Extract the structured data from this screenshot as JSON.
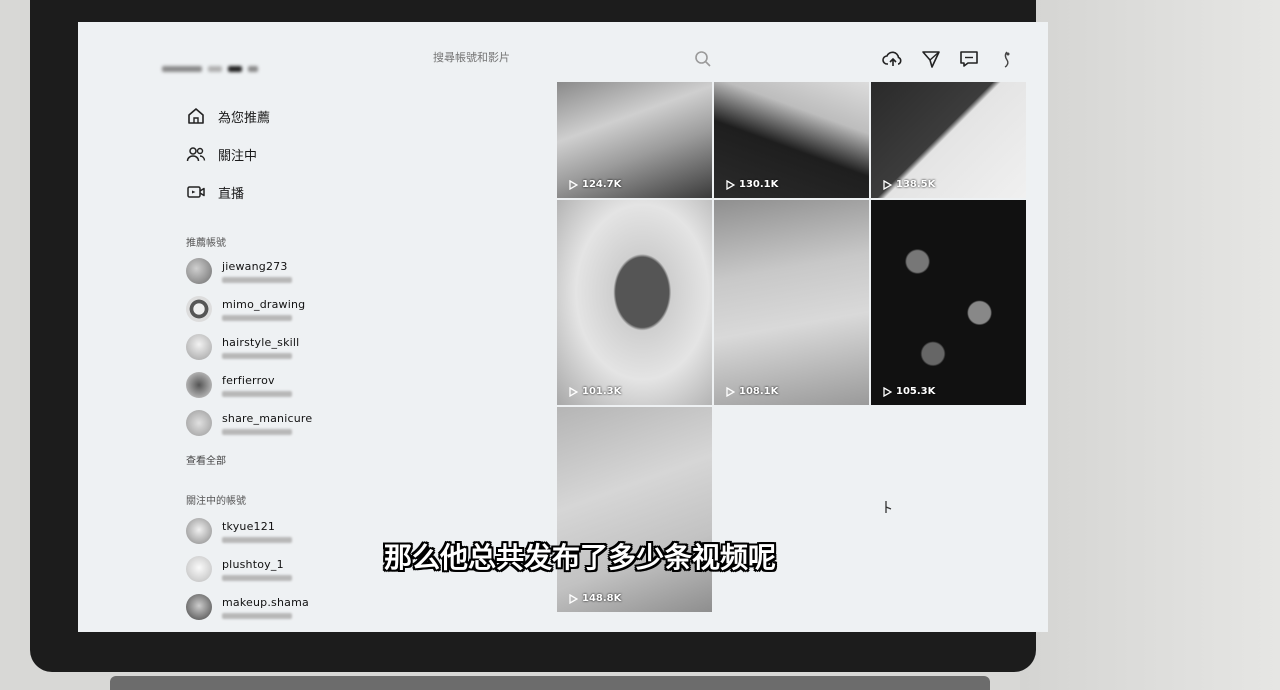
{
  "search": {
    "placeholder": "搜尋帳號和影片"
  },
  "nav": [
    {
      "label": "為您推薦",
      "icon": "home-icon"
    },
    {
      "label": "關注中",
      "icon": "users-icon"
    },
    {
      "label": "直播",
      "icon": "live-video-icon"
    }
  ],
  "sections": {
    "suggested": "推薦帳號",
    "see_all": "查看全部",
    "following": "關注中的帳號"
  },
  "suggested_accounts": [
    {
      "name": "jiewang273"
    },
    {
      "name": "mimo_drawing"
    },
    {
      "name": "hairstyle_skill"
    },
    {
      "name": "ferfierrov"
    },
    {
      "name": "share_manicure"
    }
  ],
  "following_accounts": [
    {
      "name": "tkyue121"
    },
    {
      "name": "plushtoy_1"
    },
    {
      "name": "makeup.shama"
    }
  ],
  "videos": [
    {
      "views": "124.7K"
    },
    {
      "views": "130.1K"
    },
    {
      "views": "138.5K"
    },
    {
      "views": "101.3K"
    },
    {
      "views": "108.1K"
    },
    {
      "views": "105.3K"
    },
    {
      "views": "148.8K"
    }
  ],
  "caption": "那么他总共发布了多少条视频呢",
  "colors": {
    "screen_bg": "#eef1f3",
    "bezel": "#1c1c1c",
    "text": "#1a1a1a"
  }
}
